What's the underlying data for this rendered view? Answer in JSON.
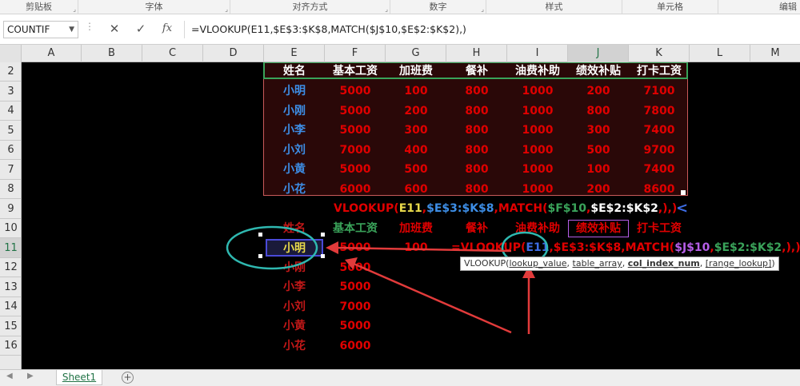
{
  "ribbon": {
    "groups": [
      {
        "label": "剪贴板"
      },
      {
        "label": "字体"
      },
      {
        "label": "对齐方式"
      },
      {
        "label": "数字"
      },
      {
        "label": "样式"
      },
      {
        "label": "单元格"
      },
      {
        "label": "编辑"
      }
    ]
  },
  "formula_bar": {
    "name_box": "COUNTIF",
    "fx_label": "fx",
    "formula": "=VLOOKUP(E11,$E$3:$K$8,MATCH($J$10,$E$2:$K$2),)"
  },
  "columns": [
    "A",
    "B",
    "C",
    "D",
    "E",
    "F",
    "G",
    "H",
    "I",
    "J",
    "K",
    "L",
    "M"
  ],
  "rows": [
    "2",
    "3",
    "4",
    "5",
    "6",
    "7",
    "8",
    "9",
    "10",
    "11",
    "12",
    "13",
    "14",
    "15",
    "16"
  ],
  "table": {
    "headers": [
      "姓名",
      "基本工资",
      "加班费",
      "餐补",
      "油费补助",
      "绩效补贴",
      "打卡工资"
    ],
    "rows": [
      [
        "小明",
        "5000",
        "100",
        "800",
        "1000",
        "200",
        "7100"
      ],
      [
        "小刚",
        "5000",
        "200",
        "800",
        "1000",
        "800",
        "7800"
      ],
      [
        "小李",
        "5000",
        "300",
        "800",
        "1000",
        "300",
        "7400"
      ],
      [
        "小刘",
        "7000",
        "400",
        "800",
        "1000",
        "500",
        "9700"
      ],
      [
        "小黄",
        "5000",
        "500",
        "800",
        "1000",
        "100",
        "7400"
      ],
      [
        "小花",
        "6000",
        "600",
        "800",
        "1000",
        "200",
        "8600"
      ]
    ]
  },
  "row9_formula": {
    "parts": [
      "VLOOKUP(",
      "E11",
      ",",
      "$E$3:$K$8",
      ",",
      "MATCH(",
      "$F$10",
      ",",
      "$E$2:$K$2",
      ",",
      "),)"
    ]
  },
  "lookup": {
    "headers": [
      "姓名",
      "基本工资",
      "加班费",
      "餐补",
      "油费补助",
      "绩效补贴",
      "打卡工资"
    ],
    "names": [
      "小明",
      "小刚",
      "小李",
      "小刘",
      "小黄",
      "小花"
    ],
    "base_pay": [
      "5000",
      "5000",
      "5000",
      "7000",
      "5000",
      "6000"
    ],
    "overtime_row11": "100"
  },
  "editing_formula": {
    "parts": [
      "=VLOOKUP(",
      "E11",
      ",$E$3:$K$8,",
      "MATCH(",
      "$J$10",
      ",",
      "$E$2:$K$2",
      ",),)"
    ]
  },
  "tooltip": {
    "prefix": "VLOOKUP(",
    "arg1": "lookup_value",
    "sep1": ", ",
    "arg2": "table_array",
    "sep2": ", ",
    "arg3": "col_index_num",
    "sep3": ", ",
    "arg4": "[range_lookup]",
    "suffix": ")"
  },
  "sheet_tabs": {
    "active": "Sheet1",
    "add_label": "+"
  },
  "colors": {
    "accent_green": "#217346",
    "blue_name": "#3d8ee6",
    "red_value": "#e00000",
    "header_white": "#ffffff",
    "annotation_cyan": "#2fb8b0",
    "arrow_red": "#e23b3b"
  }
}
